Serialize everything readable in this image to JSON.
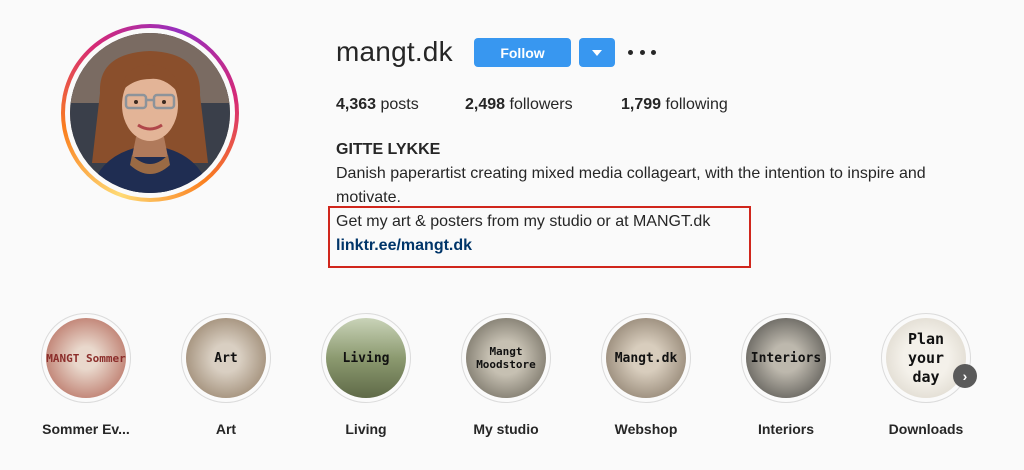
{
  "profile": {
    "username": "mangt.dk",
    "follow_label": "Follow",
    "posts_count": "4,363",
    "posts_label": "posts",
    "followers_count": "2,498",
    "followers_label": "followers",
    "following_count": "1,799",
    "following_label": "following",
    "full_name": "GITTE LYKKE",
    "bio_line1": "Danish paperartist creating mixed media collageart, with the intention to inspire and motivate.",
    "bio_line2": "Get my art & posters from my studio or at MANGT.dk",
    "link": "linktr.ee/mangt.dk"
  },
  "highlights": [
    {
      "label": "Sommer Ev...",
      "cover_text": "MANGT Sommer",
      "color": "#b5766a"
    },
    {
      "label": "Art",
      "cover_text": "Art",
      "color": "#b6a592"
    },
    {
      "label": "Living",
      "cover_text": "Living",
      "color": "#7f8b62"
    },
    {
      "label": "My studio",
      "cover_text": "Mangt Moodstore",
      "color": "#8a8478"
    },
    {
      "label": "Webshop",
      "cover_text": "Mangt.dk",
      "color": "#a99c8a"
    },
    {
      "label": "Interiors",
      "cover_text": "Interiors",
      "color": "#6f6d66"
    },
    {
      "label": "Downloads",
      "cover_text": "Plan your day",
      "color": "#e8e4dc"
    }
  ],
  "colors": {
    "follow_button": "#3897f0",
    "link": "#003569",
    "highlight_box": "#d0261c"
  }
}
